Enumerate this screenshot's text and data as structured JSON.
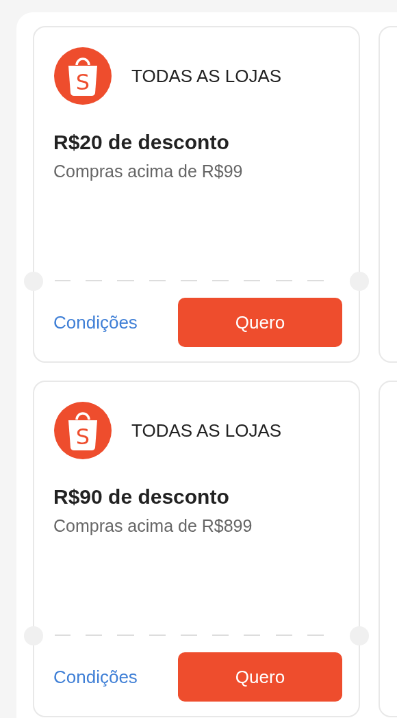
{
  "coupons": [
    {
      "logo_letter": "S",
      "store": "TODAS AS LOJAS",
      "title": "R$20 de desconto",
      "condition": "Compras acima de R$99",
      "link": "Condições",
      "button": "Quero"
    },
    {
      "logo_letter": "S",
      "store": "TODAS AS LOJAS",
      "title": "R$90 de desconto",
      "condition": "Compras acima de R$899",
      "link": "Condições",
      "button": "Quero"
    }
  ]
}
